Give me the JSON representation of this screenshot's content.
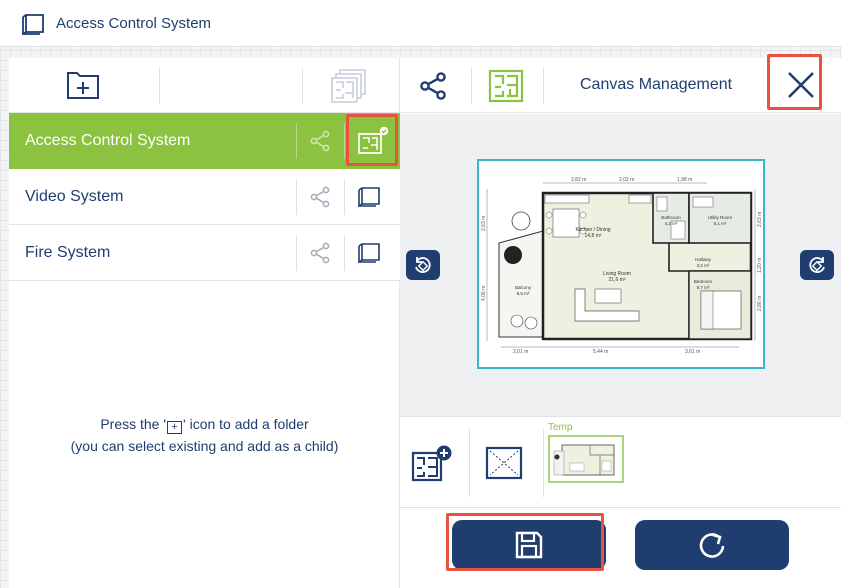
{
  "app": {
    "title": "Access Control System",
    "icon": "canvas-frame-icon"
  },
  "left_toolbar": {
    "add_folder_icon": "folder-plus-icon",
    "canvases_icon": "stacked-floorplans-icon"
  },
  "folders": [
    {
      "label": "Access Control System",
      "active": true,
      "share_icon": "share-icon",
      "canvas_icon": "floorplan-check-icon"
    },
    {
      "label": "Video System",
      "active": false,
      "share_icon": "share-icon",
      "canvas_icon": "canvas-frame-icon"
    },
    {
      "label": "Fire System",
      "active": false,
      "share_icon": "share-icon",
      "canvas_icon": "canvas-frame-icon"
    }
  ],
  "hint": {
    "before_icon": "Press the '",
    "icon_glyph": "+",
    "after_icon": "' icon to add a folder",
    "line2": "(you can select existing and add as a child)"
  },
  "right_toolbar": {
    "title": "Canvas Management",
    "share_icon": "share-icon",
    "floorplan_icon": "floorplan-icon",
    "close_icon": "close-icon"
  },
  "floorplan": {
    "rooms": [
      {
        "name": "Kitchen / Dining",
        "area": "14,8 m²"
      },
      {
        "name": "Bathroom",
        "area": "4,2 m²"
      },
      {
        "name": "Utility Room",
        "area": "5,1 m²"
      },
      {
        "name": "Living Room",
        "area": "21,6 m²"
      },
      {
        "name": "Hallway",
        "area": "3,6 m²"
      },
      {
        "name": "Bedroom",
        "area": "9,7 m²"
      },
      {
        "name": "Balcony",
        "area": "9,5 m²"
      }
    ],
    "dims_top": [
      "2,82 m",
      "2,02 m",
      "1,98 m"
    ],
    "dims_bottom": [
      "2,01 m",
      "5,44 m",
      "3,61 m"
    ],
    "dims_left": [
      "2,63 m",
      "4,06 m"
    ],
    "dims_right": [
      "2,63 m",
      "1,20 m",
      "2,86 m"
    ]
  },
  "canvases": [
    {
      "label": "Temp",
      "selected": true
    }
  ],
  "canvas_row": {
    "add_canvas_icon": "add-floorplan-icon",
    "empty_canvas_icon": "empty-canvas-icon"
  },
  "actions": {
    "save_icon": "save-icon",
    "reset_icon": "refresh-icon"
  },
  "colors": {
    "primary": "#1f3d6e",
    "accent_green": "#8bc23f",
    "highlight_red": "#e8533f",
    "preview_border": "#3bb6c7"
  }
}
